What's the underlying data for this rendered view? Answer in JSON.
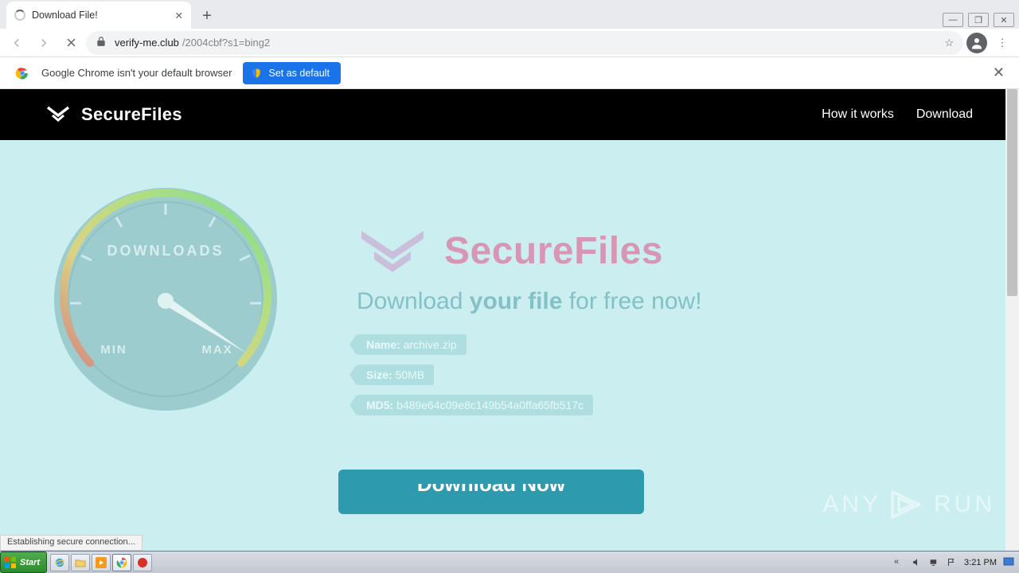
{
  "browser": {
    "tab_title": "Download File!",
    "url_domain": "verify-me.club",
    "url_path": "/2004cbf?s1=bing2",
    "infobar_text": "Google Chrome isn't your default browser",
    "set_default_label": "Set as default",
    "status_text": "Establishing secure connection..."
  },
  "site": {
    "brand": "SecureFiles",
    "nav": {
      "how": "How it works",
      "download": "Download"
    },
    "gauge": {
      "title": "DOWNLOADS",
      "min": "MIN",
      "max": "MAX"
    },
    "subhead_a": "Download ",
    "subhead_b": "your file",
    "subhead_c": " for free now!",
    "file": {
      "name_k": "Name:",
      "name_v": "archive.zip",
      "size_k": "Size:",
      "size_v": "50MB",
      "md5_k": "MD5:",
      "md5_v": "b489e64c09e8c149b54a0ffa65fb517c"
    },
    "dl_label": "Download Now"
  },
  "watermark": {
    "text": "ANY",
    "text2": "RUN"
  },
  "taskbar": {
    "start": "Start",
    "clock": "3:21 PM"
  }
}
